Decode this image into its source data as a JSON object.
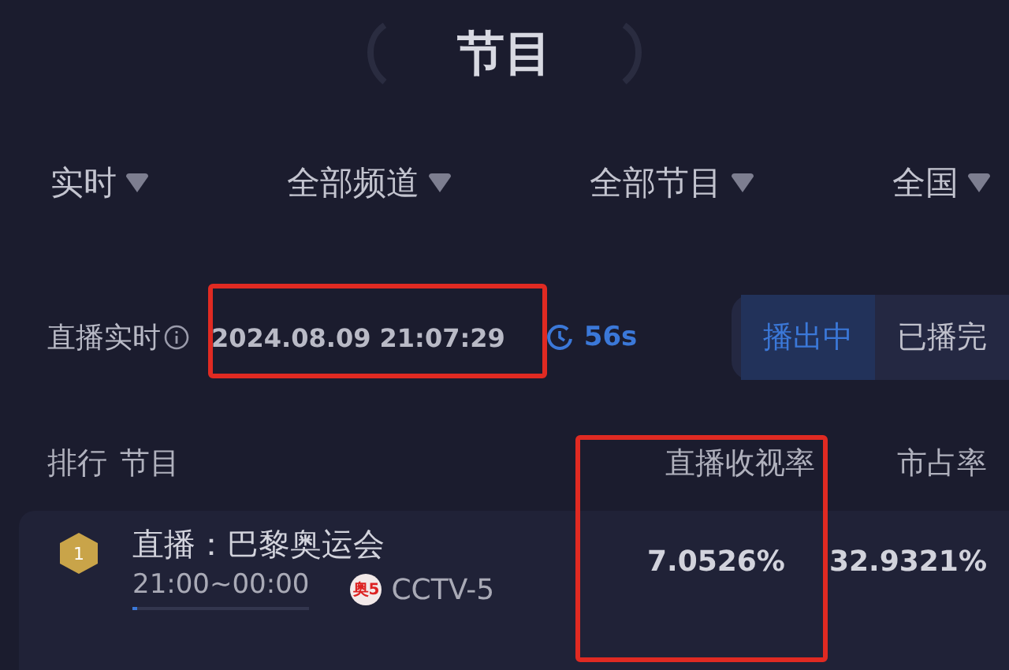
{
  "title": "节目",
  "filters": [
    {
      "label": "实时"
    },
    {
      "label": "全部频道"
    },
    {
      "label": "全部节目"
    },
    {
      "label": "全国"
    }
  ],
  "live": {
    "label": "直播实时",
    "timestamp": "2024.08.09 21:07:29",
    "refresh": "56s"
  },
  "toggle": [
    {
      "label": "播出中",
      "selected": true
    },
    {
      "label": "已播完",
      "selected": false
    }
  ],
  "table": {
    "columns": [
      "排行",
      "节目",
      "直播收视率",
      "市占率"
    ],
    "rows": [
      {
        "rank": "1",
        "name": "直播：巴黎奥运会",
        "time": "21:00~00:00",
        "level": 0.03,
        "channel_badge": "奥5",
        "channel": "CCTV-5",
        "rating": "7.0526%",
        "share": "32.9321%"
      }
    ]
  }
}
